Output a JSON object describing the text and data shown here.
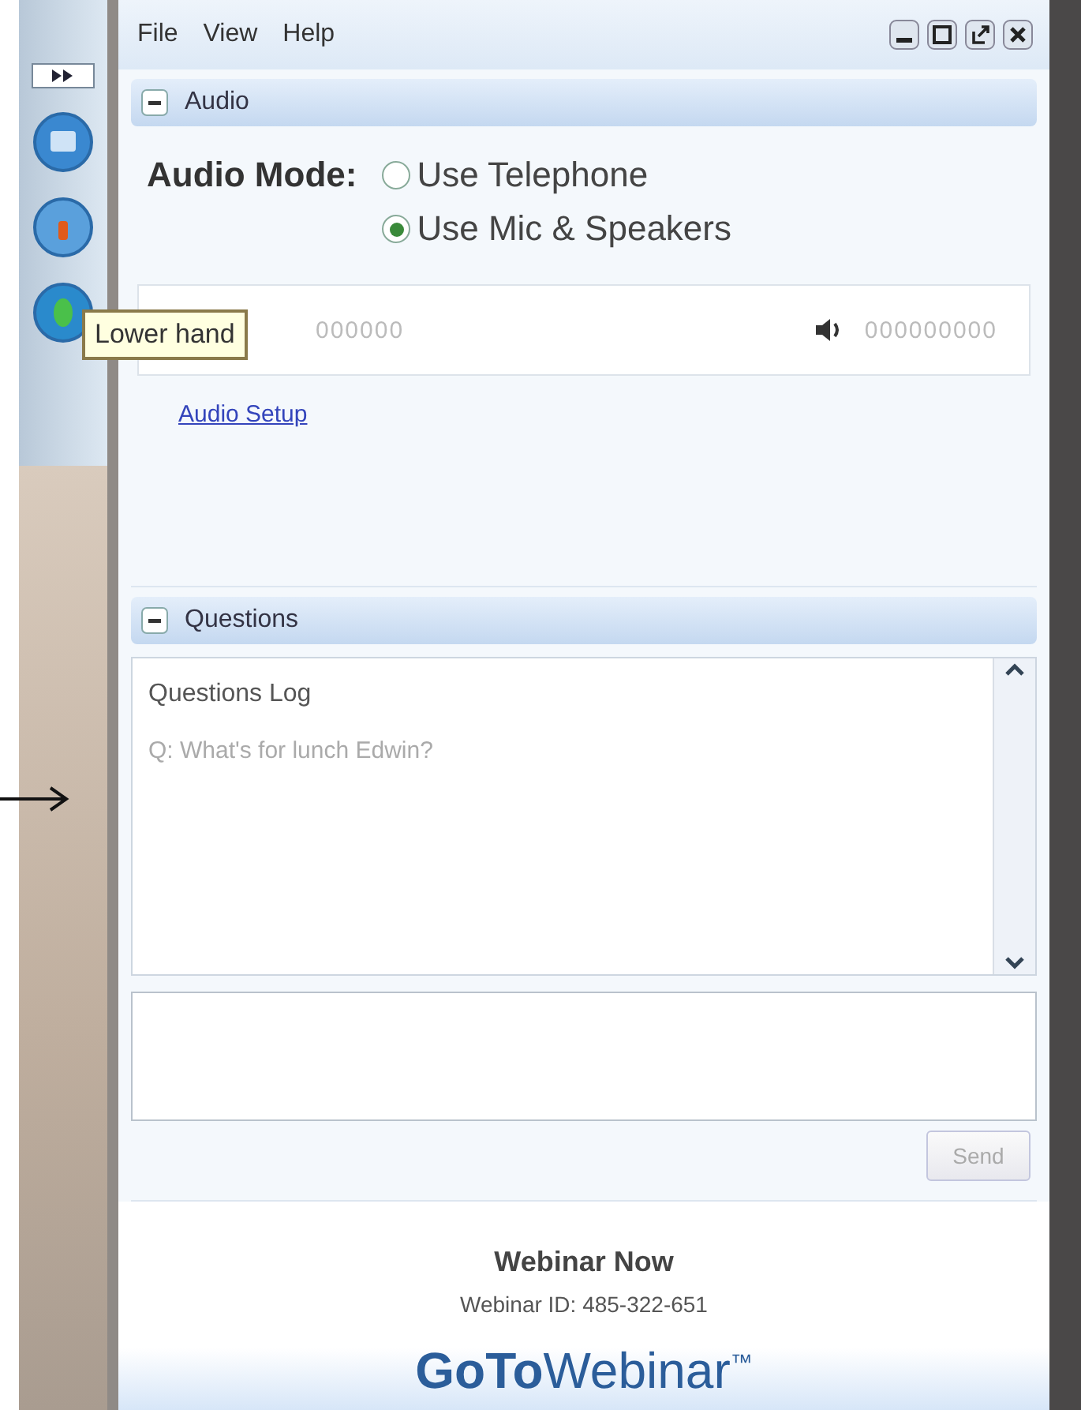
{
  "tooltip": {
    "text": "Lower hand"
  },
  "menu": [
    "File",
    "View",
    "Help"
  ],
  "audio": {
    "title": "Audio",
    "mode_label": "Audio Mode:",
    "options": [
      {
        "label": "Use Telephone",
        "selected": false
      },
      {
        "label": "Use Mic & Speakers",
        "selected": true
      }
    ],
    "mic_value": "000000",
    "speaker_value": "000000000",
    "setup_link": "Audio Setup"
  },
  "questions": {
    "title": "Questions",
    "log_title": "Questions Log",
    "entries": [
      "Q: What's for lunch Edwin?"
    ],
    "send": {
      "label": "Send",
      "disabled": true
    }
  },
  "footer": {
    "title": "Webinar Now",
    "webinar_id": "Webinar ID: 485-322-651",
    "logo_bold": "GoTo",
    "logo_light": "Webinar",
    "logo_mark": "™"
  }
}
